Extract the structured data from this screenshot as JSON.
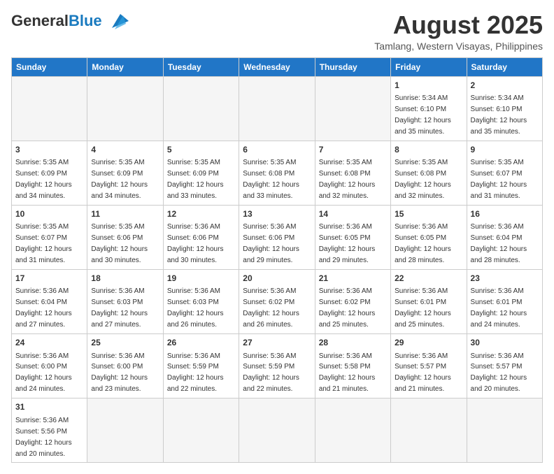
{
  "header": {
    "logo_general": "General",
    "logo_blue": "Blue",
    "title": "August 2025",
    "subtitle": "Tamlang, Western Visayas, Philippines"
  },
  "days_of_week": [
    "Sunday",
    "Monday",
    "Tuesday",
    "Wednesday",
    "Thursday",
    "Friday",
    "Saturday"
  ],
  "weeks": [
    [
      {
        "day": "",
        "info": ""
      },
      {
        "day": "",
        "info": ""
      },
      {
        "day": "",
        "info": ""
      },
      {
        "day": "",
        "info": ""
      },
      {
        "day": "",
        "info": ""
      },
      {
        "day": "1",
        "info": "Sunrise: 5:34 AM\nSunset: 6:10 PM\nDaylight: 12 hours\nand 35 minutes."
      },
      {
        "day": "2",
        "info": "Sunrise: 5:34 AM\nSunset: 6:10 PM\nDaylight: 12 hours\nand 35 minutes."
      }
    ],
    [
      {
        "day": "3",
        "info": "Sunrise: 5:35 AM\nSunset: 6:09 PM\nDaylight: 12 hours\nand 34 minutes."
      },
      {
        "day": "4",
        "info": "Sunrise: 5:35 AM\nSunset: 6:09 PM\nDaylight: 12 hours\nand 34 minutes."
      },
      {
        "day": "5",
        "info": "Sunrise: 5:35 AM\nSunset: 6:09 PM\nDaylight: 12 hours\nand 33 minutes."
      },
      {
        "day": "6",
        "info": "Sunrise: 5:35 AM\nSunset: 6:08 PM\nDaylight: 12 hours\nand 33 minutes."
      },
      {
        "day": "7",
        "info": "Sunrise: 5:35 AM\nSunset: 6:08 PM\nDaylight: 12 hours\nand 32 minutes."
      },
      {
        "day": "8",
        "info": "Sunrise: 5:35 AM\nSunset: 6:08 PM\nDaylight: 12 hours\nand 32 minutes."
      },
      {
        "day": "9",
        "info": "Sunrise: 5:35 AM\nSunset: 6:07 PM\nDaylight: 12 hours\nand 31 minutes."
      }
    ],
    [
      {
        "day": "10",
        "info": "Sunrise: 5:35 AM\nSunset: 6:07 PM\nDaylight: 12 hours\nand 31 minutes."
      },
      {
        "day": "11",
        "info": "Sunrise: 5:35 AM\nSunset: 6:06 PM\nDaylight: 12 hours\nand 30 minutes."
      },
      {
        "day": "12",
        "info": "Sunrise: 5:36 AM\nSunset: 6:06 PM\nDaylight: 12 hours\nand 30 minutes."
      },
      {
        "day": "13",
        "info": "Sunrise: 5:36 AM\nSunset: 6:06 PM\nDaylight: 12 hours\nand 29 minutes."
      },
      {
        "day": "14",
        "info": "Sunrise: 5:36 AM\nSunset: 6:05 PM\nDaylight: 12 hours\nand 29 minutes."
      },
      {
        "day": "15",
        "info": "Sunrise: 5:36 AM\nSunset: 6:05 PM\nDaylight: 12 hours\nand 28 minutes."
      },
      {
        "day": "16",
        "info": "Sunrise: 5:36 AM\nSunset: 6:04 PM\nDaylight: 12 hours\nand 28 minutes."
      }
    ],
    [
      {
        "day": "17",
        "info": "Sunrise: 5:36 AM\nSunset: 6:04 PM\nDaylight: 12 hours\nand 27 minutes."
      },
      {
        "day": "18",
        "info": "Sunrise: 5:36 AM\nSunset: 6:03 PM\nDaylight: 12 hours\nand 27 minutes."
      },
      {
        "day": "19",
        "info": "Sunrise: 5:36 AM\nSunset: 6:03 PM\nDaylight: 12 hours\nand 26 minutes."
      },
      {
        "day": "20",
        "info": "Sunrise: 5:36 AM\nSunset: 6:02 PM\nDaylight: 12 hours\nand 26 minutes."
      },
      {
        "day": "21",
        "info": "Sunrise: 5:36 AM\nSunset: 6:02 PM\nDaylight: 12 hours\nand 25 minutes."
      },
      {
        "day": "22",
        "info": "Sunrise: 5:36 AM\nSunset: 6:01 PM\nDaylight: 12 hours\nand 25 minutes."
      },
      {
        "day": "23",
        "info": "Sunrise: 5:36 AM\nSunset: 6:01 PM\nDaylight: 12 hours\nand 24 minutes."
      }
    ],
    [
      {
        "day": "24",
        "info": "Sunrise: 5:36 AM\nSunset: 6:00 PM\nDaylight: 12 hours\nand 24 minutes."
      },
      {
        "day": "25",
        "info": "Sunrise: 5:36 AM\nSunset: 6:00 PM\nDaylight: 12 hours\nand 23 minutes."
      },
      {
        "day": "26",
        "info": "Sunrise: 5:36 AM\nSunset: 5:59 PM\nDaylight: 12 hours\nand 22 minutes."
      },
      {
        "day": "27",
        "info": "Sunrise: 5:36 AM\nSunset: 5:59 PM\nDaylight: 12 hours\nand 22 minutes."
      },
      {
        "day": "28",
        "info": "Sunrise: 5:36 AM\nSunset: 5:58 PM\nDaylight: 12 hours\nand 21 minutes."
      },
      {
        "day": "29",
        "info": "Sunrise: 5:36 AM\nSunset: 5:57 PM\nDaylight: 12 hours\nand 21 minutes."
      },
      {
        "day": "30",
        "info": "Sunrise: 5:36 AM\nSunset: 5:57 PM\nDaylight: 12 hours\nand 20 minutes."
      }
    ],
    [
      {
        "day": "31",
        "info": "Sunrise: 5:36 AM\nSunset: 5:56 PM\nDaylight: 12 hours\nand 20 minutes."
      },
      {
        "day": "",
        "info": ""
      },
      {
        "day": "",
        "info": ""
      },
      {
        "day": "",
        "info": ""
      },
      {
        "day": "",
        "info": ""
      },
      {
        "day": "",
        "info": ""
      },
      {
        "day": "",
        "info": ""
      }
    ]
  ]
}
